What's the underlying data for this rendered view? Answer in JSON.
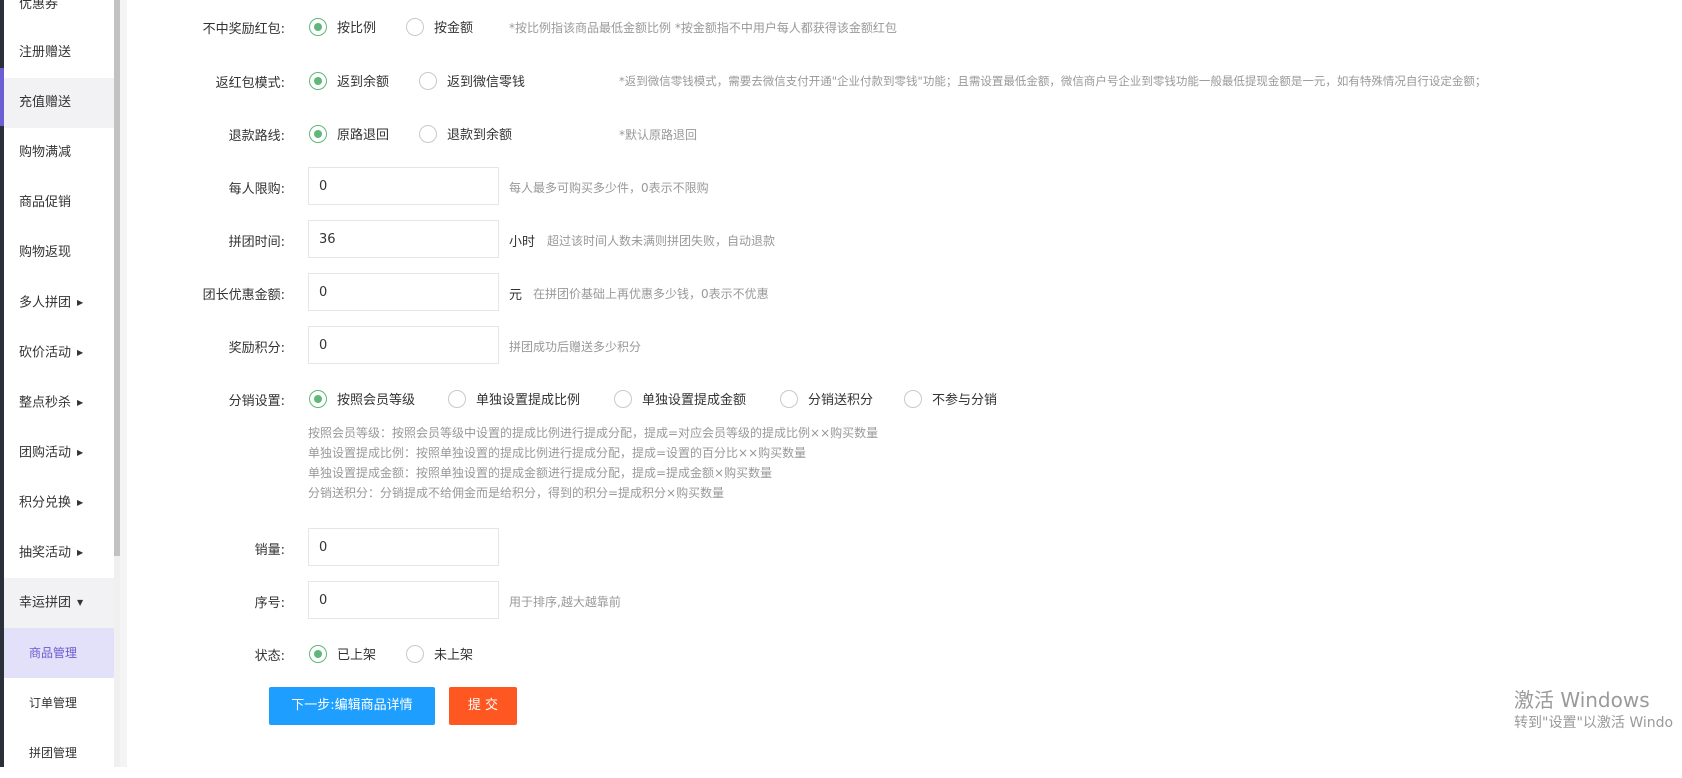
{
  "sidebar": {
    "items": [
      {
        "label": "优惠券"
      },
      {
        "label": "注册赠送"
      },
      {
        "label": "充值赠送"
      },
      {
        "label": "购物满减"
      },
      {
        "label": "商品促销"
      },
      {
        "label": "购物返现"
      },
      {
        "label": "多人拼团",
        "caret": "▶"
      },
      {
        "label": "砍价活动",
        "caret": "▶"
      },
      {
        "label": "整点秒杀",
        "caret": "▶"
      },
      {
        "label": "团购活动",
        "caret": "▶"
      },
      {
        "label": "积分兑换",
        "caret": "▶"
      },
      {
        "label": "抽奖活动",
        "caret": "▶"
      },
      {
        "label": "幸运拼团",
        "caret": "▼"
      }
    ],
    "subitems": [
      {
        "label": "商品管理"
      },
      {
        "label": "订单管理"
      },
      {
        "label": "拼团管理"
      }
    ]
  },
  "form": {
    "loser_redpacket": {
      "label": "不中奖励红包:",
      "options": [
        "按比例",
        "按金额"
      ],
      "selected": "按比例",
      "hint": "*按比例指该商品最低金额比例   *按金额指不中用户每人都获得该金额红包"
    },
    "redpacket_mode": {
      "label": "返红包模式:",
      "options": [
        "返到余额",
        "返到微信零钱"
      ],
      "selected": "返到余额",
      "hint": "*返到微信零钱模式，需要去微信支付开通\"企业付款到零钱\"功能；且需设置最低金额，微信商户号企业到零钱功能一般最低提现金额是一元，如有特殊情况自行设定金额；"
    },
    "refund_route": {
      "label": "退款路线:",
      "options": [
        "原路退回",
        "退款到余额"
      ],
      "selected": "原路退回",
      "hint": "*默认原路退回"
    },
    "per_person_limit": {
      "label": "每人限购:",
      "value": "0",
      "hint": "每人最多可购买多少件，0表示不限购"
    },
    "group_time": {
      "label": "拼团时间:",
      "value": "36",
      "unit": "小时",
      "hint": "超过该时间人数未满则拼团失败，自动退款"
    },
    "leader_discount": {
      "label": "团长优惠金额:",
      "value": "0",
      "unit": "元",
      "hint": "在拼团价基础上再优惠多少钱，0表示不优惠"
    },
    "reward_points": {
      "label": "奖励积分:",
      "value": "0",
      "hint": "拼团成功后赠送多少积分"
    },
    "distribution": {
      "label": "分销设置:",
      "options": [
        "按照会员等级",
        "单独设置提成比例",
        "单独设置提成金额",
        "分销送积分",
        "不参与分销"
      ],
      "selected": "按照会员等级",
      "notes": [
        "按照会员等级：按照会员等级中设置的提成比例进行提成分配，提成=对应会员等级的提成比例××购买数量",
        "单独设置提成比例：按照单独设置的提成比例进行提成分配，提成=设置的百分比××购买数量",
        "单独设置提成金额：按照单独设置的提成金额进行提成分配，提成=提成金额×购买数量",
        "分销送积分：分销提成不给佣金而是给积分，得到的积分=提成积分×购买数量"
      ]
    },
    "sales": {
      "label": "销量:",
      "value": "0"
    },
    "sort_order": {
      "label": "序号:",
      "value": "0",
      "hint": "用于排序,越大越靠前"
    },
    "status": {
      "label": "状态:",
      "options": [
        "已上架",
        "未上架"
      ],
      "selected": "已上架"
    }
  },
  "buttons": {
    "next": "下一步:编辑商品详情",
    "submit": "提 交"
  },
  "watermark": {
    "line1": "激活 Windows",
    "line2": "转到\"设置\"以激活 Windo"
  },
  "colors": {
    "accent_green": "#5fb878",
    "button_blue": "#1e9fff",
    "button_orange": "#ff5722",
    "sidebar_selected": "#e3e1fa"
  }
}
